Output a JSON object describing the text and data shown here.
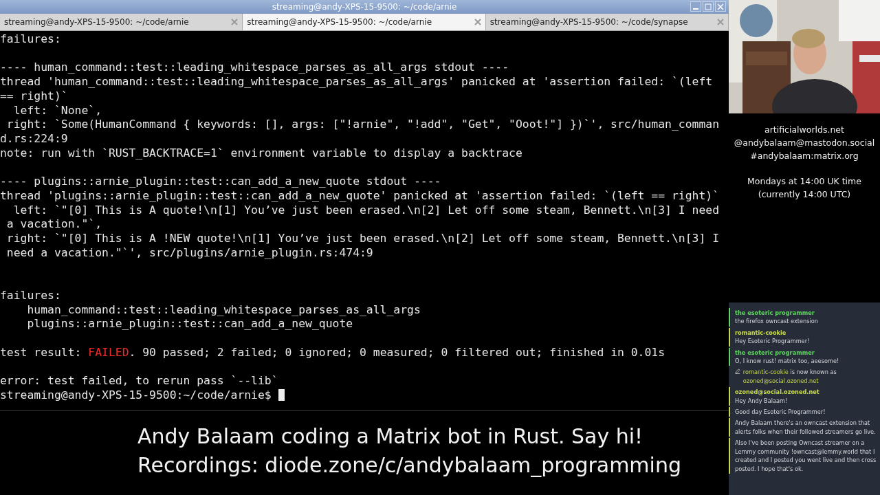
{
  "window": {
    "title": "streaming@andy-XPS-15-9500: ~/code/arnie"
  },
  "tabs": [
    {
      "label": "streaming@andy-XPS-15-9500: ~/code/arnie",
      "selected": false
    },
    {
      "label": "streaming@andy-XPS-15-9500: ~/code/arnie",
      "selected": true
    },
    {
      "label": "streaming@andy-XPS-15-9500: ~/code/synapse",
      "selected": false
    }
  ],
  "terminal": {
    "lines": [
      {
        "kind": "text",
        "text": "failures:"
      },
      {
        "kind": "blank"
      },
      {
        "kind": "text",
        "text": "---- human_command::test::leading_whitespace_parses_as_all_args stdout ----"
      },
      {
        "kind": "text",
        "text": "thread 'human_command::test::leading_whitespace_parses_as_all_args' panicked at 'assertion failed: `(left"
      },
      {
        "kind": "text",
        "text": "== right)`"
      },
      {
        "kind": "text",
        "text": "  left: `None`,"
      },
      {
        "kind": "text",
        "text": " right: `Some(HumanCommand { keywords: [], args: [\"!arnie\", \"!add\", \"Get\", \"Ooot!\"] })`', src/human_comman"
      },
      {
        "kind": "text",
        "text": "d.rs:224:9"
      },
      {
        "kind": "text",
        "text": "note: run with `RUST_BACKTRACE=1` environment variable to display a backtrace"
      },
      {
        "kind": "blank"
      },
      {
        "kind": "text",
        "text": "---- plugins::arnie_plugin::test::can_add_a_new_quote stdout ----"
      },
      {
        "kind": "text",
        "text": "thread 'plugins::arnie_plugin::test::can_add_a_new_quote' panicked at 'assertion failed: `(left == right)`"
      },
      {
        "kind": "text",
        "text": "  left: `\"[0] This is A quote!\\n[1] You’ve just been erased.\\n[2] Let off some steam, Bennett.\\n[3] I need"
      },
      {
        "kind": "text",
        "text": " a vacation.\"`,"
      },
      {
        "kind": "text",
        "text": " right: `\"[0] This is A !NEW quote!\\n[1] You’ve just been erased.\\n[2] Let off some steam, Bennett.\\n[3] I"
      },
      {
        "kind": "text",
        "text": " need a vacation.\"`', src/plugins/arnie_plugin.rs:474:9"
      },
      {
        "kind": "blank"
      },
      {
        "kind": "blank"
      },
      {
        "kind": "text",
        "text": "failures:"
      },
      {
        "kind": "text",
        "text": "    human_command::test::leading_whitespace_parses_as_all_args"
      },
      {
        "kind": "text",
        "text": "    plugins::arnie_plugin::test::can_add_a_new_quote"
      },
      {
        "kind": "blank"
      },
      {
        "kind": "result",
        "prefix": "test result:",
        "status": "FAILED",
        "suffix": ". 90 passed; 2 failed; 0 ignored; 0 measured; 0 filtered out; finished in 0.01s"
      },
      {
        "kind": "blank"
      },
      {
        "kind": "text",
        "text": "error: test failed, to rerun pass `--lib`"
      },
      {
        "kind": "prompt",
        "text": "streaming@andy-XPS-15-9500:~/code/arnie$"
      }
    ]
  },
  "banner": [
    "Andy Balaam coding a Matrix bot in Rust. Say hi!",
    "Recordings: diode.zone/c/andybalaam_programming"
  ],
  "info": {
    "links": [
      "artificialworlds.net",
      "@andybalaam@mastodon.social",
      "#andybalaam:matrix.org"
    ],
    "schedule": [
      "Mondays at 14:00 UK time",
      "(currently 14:00 UTC)"
    ]
  },
  "chat": [
    {
      "kind": "message",
      "author": "the esoteric programmer",
      "color": "#5fd35f",
      "text": "the firefox owncast extension"
    },
    {
      "kind": "message",
      "author": "romantic-cookie",
      "color": "#c8d94a",
      "text": "Hey Esoteric Programmer!"
    },
    {
      "kind": "message",
      "author": "the esoteric programmer",
      "color": "#5fd35f",
      "text": "O, I know rust! matrix too, aeesome!"
    },
    {
      "kind": "rename",
      "old": "romantic-cookie",
      "middle": "is now known as",
      "new": "ozoned@social.ozoned.net"
    },
    {
      "kind": "message",
      "author": "ozoned@social.ozoned.net",
      "color": "#c8d94a",
      "text": "Hey Andy Balaam!"
    },
    {
      "kind": "message",
      "color": "#c8d94a",
      "text": "Good day Esoteric Programmer!"
    },
    {
      "kind": "message",
      "color": "#c8d94a",
      "text": "Andy Balaam there's an owncast extension that alerts folks when their followed streamers go live."
    },
    {
      "kind": "message",
      "color": "#c8d94a",
      "text": "Also I've been posting Owncast streamer on a Lemmy community !owncast@lemmy.world that I created and I posted you went live and then cross posted. I hope that's ok."
    }
  ]
}
